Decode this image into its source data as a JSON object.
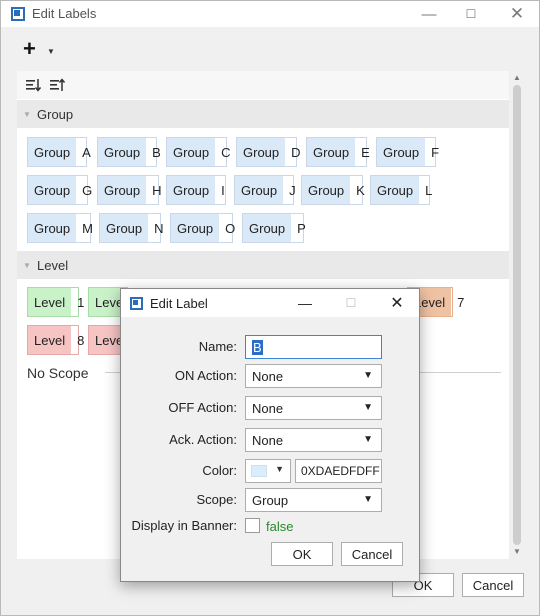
{
  "window": {
    "title": "Edit Labels"
  },
  "toolbar": {
    "add_label": "+"
  },
  "sections": {
    "group": {
      "title": "Group",
      "chips": [
        {
          "key": "Group",
          "value": "A"
        },
        {
          "key": "Group",
          "value": "B"
        },
        {
          "key": "Group",
          "value": "C"
        },
        {
          "key": "Group",
          "value": "D"
        },
        {
          "key": "Group",
          "value": "E"
        },
        {
          "key": "Group",
          "value": "F"
        },
        {
          "key": "Group",
          "value": "G"
        },
        {
          "key": "Group",
          "value": "H"
        },
        {
          "key": "Group",
          "value": "I"
        },
        {
          "key": "Group",
          "value": "J"
        },
        {
          "key": "Group",
          "value": "K"
        },
        {
          "key": "Group",
          "value": "L"
        },
        {
          "key": "Group",
          "value": "M"
        },
        {
          "key": "Group",
          "value": "N"
        },
        {
          "key": "Group",
          "value": "O"
        },
        {
          "key": "Group",
          "value": "P"
        }
      ]
    },
    "level": {
      "title": "Level",
      "chips": [
        {
          "key": "Level",
          "value": "1",
          "color": "green"
        },
        {
          "key": "Level",
          "value": "",
          "color": "green"
        },
        {
          "key": "Level",
          "value": "7",
          "color": "orange"
        },
        {
          "key": "Level",
          "value": "8",
          "color": "red"
        },
        {
          "key": "Level",
          "value": "",
          "color": "red"
        }
      ]
    },
    "no_scope": {
      "title": "No Scope"
    }
  },
  "footer": {
    "ok": "OK",
    "cancel": "Cancel"
  },
  "dialog": {
    "title": "Edit Label",
    "fields": {
      "name": {
        "label": "Name:",
        "value": "B"
      },
      "on_action": {
        "label": "ON Action:",
        "value": "None"
      },
      "off_action": {
        "label": "OFF Action:",
        "value": "None"
      },
      "ack_action": {
        "label": "Ack. Action:",
        "value": "None"
      },
      "color": {
        "label": "Color:",
        "value": "0XDAEDFDFF",
        "swatch": "#DAEDFD"
      },
      "scope": {
        "label": "Scope:",
        "value": "Group"
      },
      "banner": {
        "label": "Display in Banner:",
        "value": "false"
      }
    },
    "ok": "OK",
    "cancel": "Cancel"
  },
  "colors": {
    "group_key_bg": "#DAE9F7",
    "level_green": "#C9F2C9",
    "level_red": "#F7C4C4",
    "level_orange": "#F0C2A4",
    "selection": "#2D6CC7"
  }
}
